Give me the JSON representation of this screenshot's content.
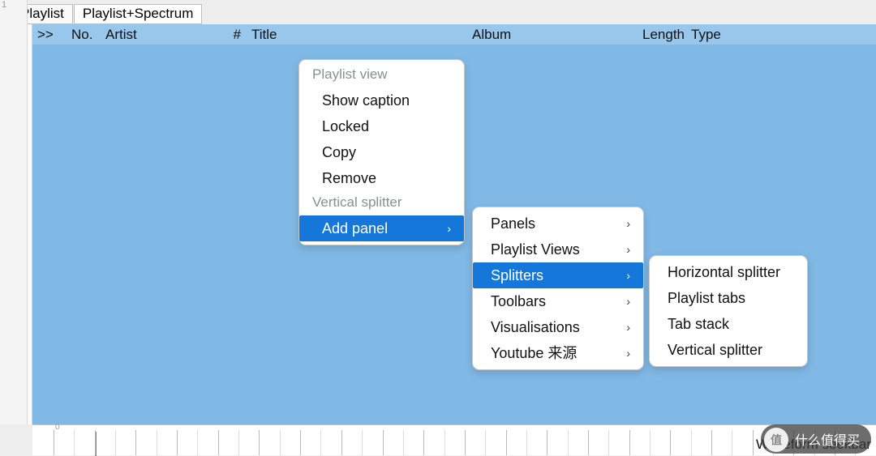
{
  "colors": {
    "highlight": "#1477d9",
    "playlist_bg": "#80b9e6",
    "header_bg": "#99c6eb"
  },
  "tabs": {
    "playlist": "Playlist",
    "playlist_spectrum": "Playlist+Spectrum"
  },
  "columns": {
    "playing": ">>",
    "no": "No.",
    "artist": "Artist",
    "track_no": "#",
    "title": "Title",
    "album": "Album",
    "length": "Length",
    "type": "Type"
  },
  "context_menu": {
    "sections": {
      "playlist_view_header": "Playlist view",
      "show_caption": "Show caption",
      "locked": "Locked",
      "copy": "Copy",
      "remove": "Remove",
      "vertical_splitter_header": "Vertical splitter",
      "add_panel": "Add panel"
    }
  },
  "add_panel_submenu": {
    "panels": "Panels",
    "playlist_views": "Playlist Views",
    "splitters": "Splitters",
    "toolbars": "Toolbars",
    "visualisations": "Visualisations",
    "youtube_source": "Youtube 来源"
  },
  "splitters_submenu": {
    "horizontal_splitter": "Horizontal splitter",
    "playlist_tabs": "Playlist tabs",
    "tab_stack": "Tab stack",
    "vertical_splitter": "Vertical splitter"
  },
  "seekbar": {
    "start_label": "0",
    "caption": "Waveform seekbar"
  },
  "ruler": {
    "top_number": "1"
  },
  "watermark": {
    "text": "什么值得买",
    "badge": "值"
  }
}
